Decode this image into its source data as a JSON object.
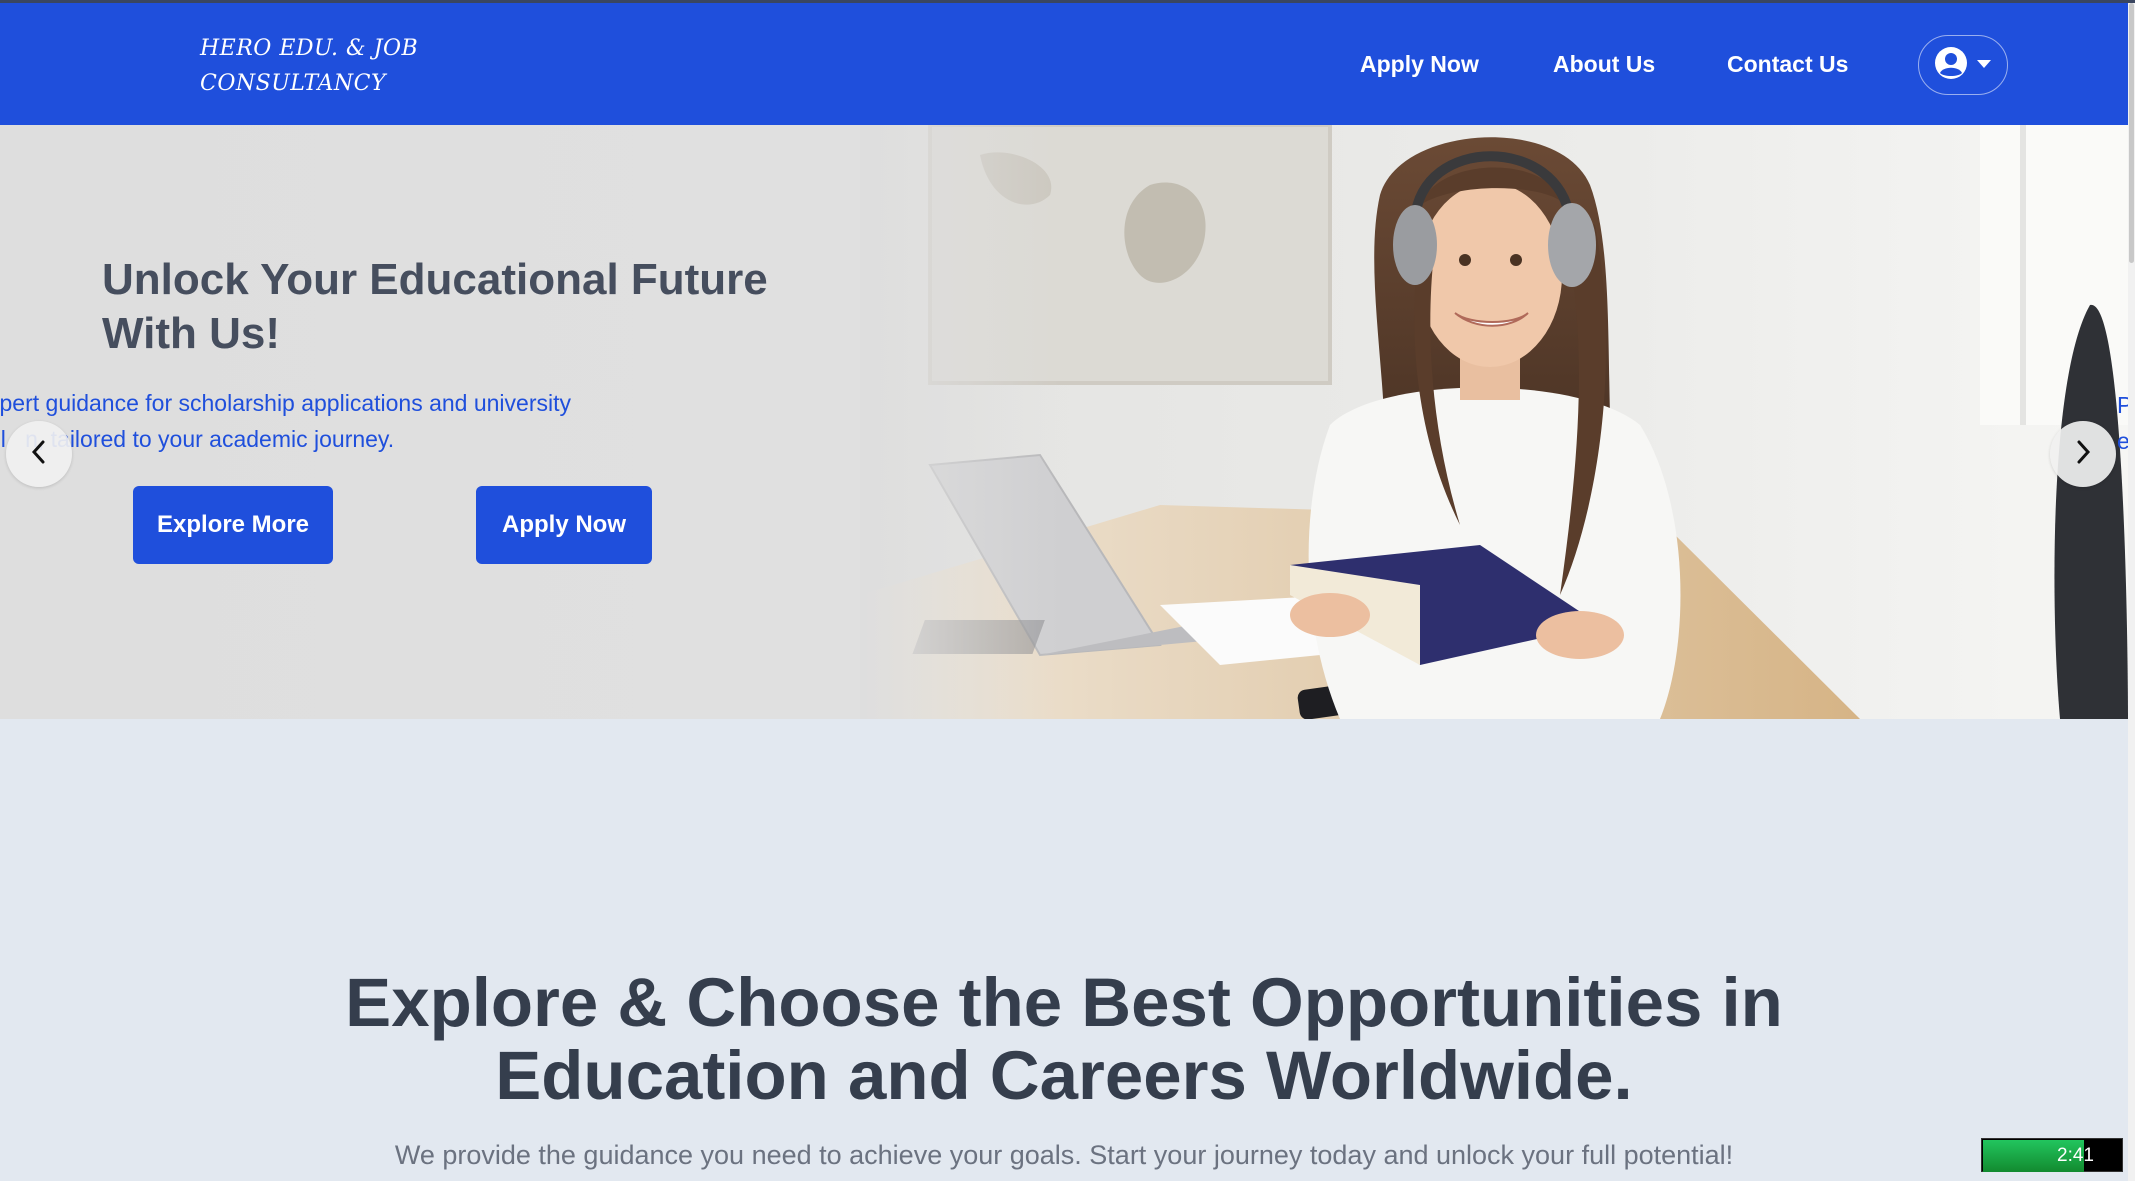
{
  "header": {
    "brand_line1": "HERO EDU. & JOB",
    "brand_line2": "CONSULTANCY",
    "nav": {
      "apply": "Apply Now",
      "about": "About Us",
      "contact": "Contact Us"
    },
    "user_menu_icon": "user-circle-icon",
    "dropdown_icon": "caret-down-icon"
  },
  "hero": {
    "title": "Unlock Your Educational Future With Us!",
    "subtitle_line1": "xpert guidance for scholarship applications and university",
    "subtitle_line2": "el   n, tailored to your academic journey.",
    "explore_label": "Explore More",
    "apply_label": "Apply Now",
    "prev_icon": "chevron-left-icon",
    "next_icon": "chevron-right-icon",
    "edge_line1": "P",
    "edge_line2": "e"
  },
  "section": {
    "title": "Explore & Choose the Best Opportunities in Education and Careers Worldwide.",
    "subtitle": "We provide the guidance you need to achieve your goals. Start your journey today and unlock your full potential!"
  },
  "timer": {
    "text": "2:41",
    "progress_fraction": 0.72
  },
  "colors": {
    "primary": "#1f4fdc",
    "page_bg": "#e2e8f0",
    "heading": "#353e4d"
  }
}
